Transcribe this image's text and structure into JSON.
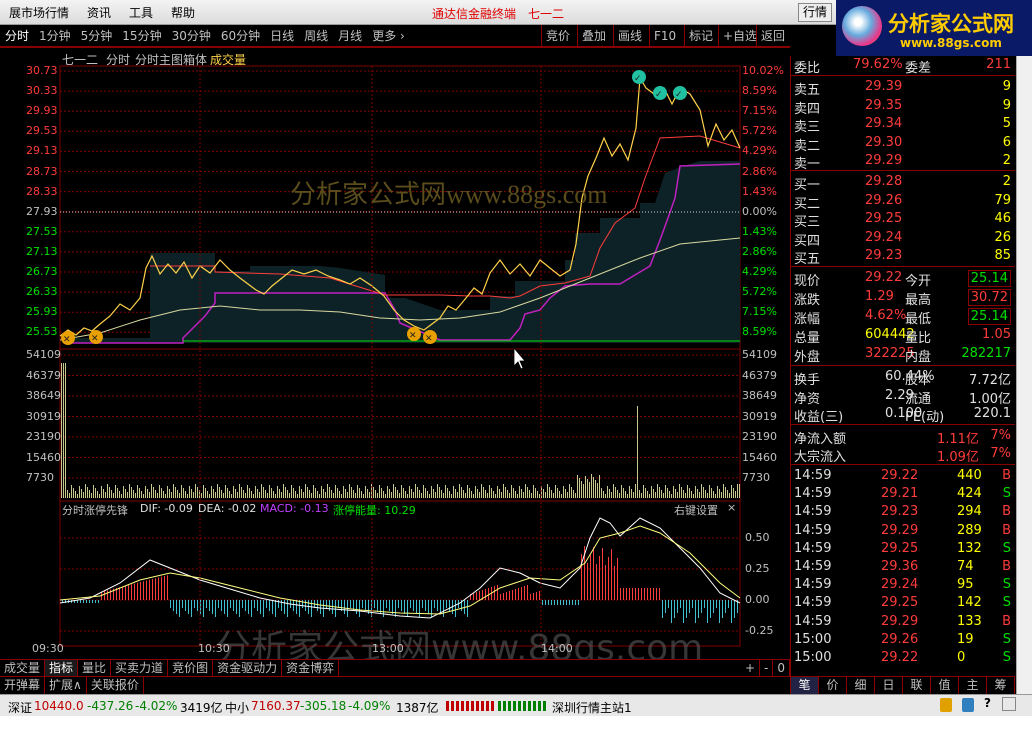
{
  "menubar": {
    "items": [
      "展市场行情",
      "资讯",
      "工具",
      "帮助"
    ],
    "app_title": "通达信金融终端",
    "stock_title": "七一二",
    "quote_button": "行情"
  },
  "logo": {
    "text": "分析家公式网",
    "url": "www.88gs.com"
  },
  "toolbar": {
    "periods": [
      "分时",
      "1分钟",
      "5分钟",
      "15分钟",
      "30分钟",
      "60分钟",
      "日线",
      "周线",
      "月线",
      "更多 ›"
    ],
    "tools": [
      "竞价",
      "叠加",
      "画线",
      "F10",
      "标记",
      "+自选",
      "返回"
    ]
  },
  "chart": {
    "title_stock": "七一二",
    "title_mode": "分时",
    "title_indicator": "分时主图箱体",
    "title_volume": "成交量",
    "price_labels": [
      "30.73",
      "30.33",
      "29.93",
      "29.53",
      "29.13",
      "28.73",
      "28.33",
      "27.93",
      "27.53",
      "27.13",
      "26.73",
      "26.33",
      "25.93",
      "25.53"
    ],
    "pct_labels": [
      "10.02%",
      "8.59%",
      "7.15%",
      "5.72%",
      "4.29%",
      "2.86%",
      "1.43%",
      "0.00%",
      "1.43%",
      "2.86%",
      "4.29%",
      "5.72%",
      "7.15%",
      "8.59%"
    ],
    "vol_labels": [
      "54109",
      "46379",
      "38649",
      "30919",
      "23190",
      "15460",
      "7730"
    ],
    "indicator_title": "分时涨停先锋",
    "dif": "DIF: -0.09",
    "dea": "DEA: -0.02",
    "macd": "MACD: -0.13",
    "energy": "涨停能量: 10.29",
    "right_settings": "右键设置",
    "close_x": "×",
    "macd_labels": [
      "0.50",
      "0.25",
      "0.00",
      "-0.25"
    ],
    "time_labels": [
      "09:30",
      "10:30",
      "13:00",
      "14:00"
    ],
    "watermark": "分析家公式网www.88gs.com",
    "watermark2": "分析家公式网www.88gs.com"
  },
  "bottom_tabs": {
    "row1": [
      "成交量",
      "指标",
      "量比",
      "买卖力道",
      "竞价图",
      "资金驱动力",
      "资金博弈"
    ],
    "row1_right": [
      "+",
      "-",
      "0"
    ],
    "row2": [
      "开弹幕",
      "扩展∧",
      "关联报价"
    ]
  },
  "statusbar": {
    "sz_name": "深证",
    "sz_value": "10440.0",
    "sz_change": "-437.26",
    "sz_pct": "-4.02%",
    "sz_amount": "3419亿",
    "zx_name": "中小",
    "zx_value": "7160.37",
    "zx_change": "-305.18",
    "zx_pct": "-4.09%",
    "zx_amount": "1387亿",
    "station": "深圳行情主站1"
  },
  "order_book": {
    "weibi_label": "委比",
    "weibi_value": "79.62%",
    "weicha_label": "委差",
    "weicha_value": "211",
    "asks": [
      {
        "label": "卖五",
        "price": "29.39",
        "vol": "9"
      },
      {
        "label": "卖四",
        "price": "29.35",
        "vol": "9"
      },
      {
        "label": "卖三",
        "price": "29.34",
        "vol": "5"
      },
      {
        "label": "卖二",
        "price": "29.30",
        "vol": "6"
      },
      {
        "label": "卖一",
        "price": "29.29",
        "vol": "2"
      }
    ],
    "bids": [
      {
        "label": "买一",
        "price": "29.28",
        "vol": "2"
      },
      {
        "label": "买二",
        "price": "29.26",
        "vol": "79"
      },
      {
        "label": "买三",
        "price": "29.25",
        "vol": "46"
      },
      {
        "label": "买四",
        "price": "29.24",
        "vol": "26"
      },
      {
        "label": "买五",
        "price": "29.23",
        "vol": "85"
      }
    ]
  },
  "quote": {
    "rows": [
      {
        "l1": "现价",
        "v1": "29.22",
        "l2": "今开",
        "v2": "25.14"
      },
      {
        "l1": "涨跌",
        "v1": "1.29",
        "l2": "最高",
        "v2": "30.72"
      },
      {
        "l1": "涨幅",
        "v1": "4.62%",
        "l2": "最低",
        "v2": "25.14"
      },
      {
        "l1": "总量",
        "v1": "604442",
        "l2": "量比",
        "v2": "1.05"
      },
      {
        "l1": "外盘",
        "v1": "322225",
        "l2": "内盘",
        "v2": "282217"
      }
    ],
    "rows2": [
      {
        "l1": "换手",
        "v1": "60.44%",
        "l2": "股本",
        "v2": "7.72亿"
      },
      {
        "l1": "净资",
        "v1": "2.29",
        "l2": "流通",
        "v2": "1.00亿"
      },
      {
        "l1": "收益(三)",
        "v1": "0.100",
        "l2": "PE(动)",
        "v2": "220.1"
      }
    ],
    "net_inflow_label": "净流入额",
    "net_inflow_value": "1.11亿",
    "net_inflow_pct": "7%",
    "block_inflow_label": "大宗流入",
    "block_inflow_value": "1.09亿",
    "block_inflow_pct": "7%"
  },
  "ticks": [
    {
      "t": "14:59",
      "p": "29.22",
      "v": "440",
      "s": "B"
    },
    {
      "t": "14:59",
      "p": "29.21",
      "v": "424",
      "s": "S"
    },
    {
      "t": "14:59",
      "p": "29.23",
      "v": "294",
      "s": "B"
    },
    {
      "t": "14:59",
      "p": "29.29",
      "v": "289",
      "s": "B"
    },
    {
      "t": "14:59",
      "p": "29.25",
      "v": "132",
      "s": "S"
    },
    {
      "t": "14:59",
      "p": "29.36",
      "v": "74",
      "s": "B"
    },
    {
      "t": "14:59",
      "p": "29.24",
      "v": "95",
      "s": "S"
    },
    {
      "t": "14:59",
      "p": "29.25",
      "v": "142",
      "s": "S"
    },
    {
      "t": "14:59",
      "p": "29.29",
      "v": "133",
      "s": "B"
    },
    {
      "t": "15:00",
      "p": "29.26",
      "v": "19",
      "s": "S"
    },
    {
      "t": "15:00",
      "p": "29.22",
      "v": "0",
      "s": "S"
    }
  ],
  "right_tabs": [
    "笔",
    "价",
    "细",
    "日",
    "联",
    "值",
    "主",
    "筹"
  ],
  "colors": {
    "up": "#ff3c3c",
    "down": "#00e000",
    "grid": "#800000",
    "price_line": "#ffd24a",
    "box_purple": "#c020c0"
  }
}
